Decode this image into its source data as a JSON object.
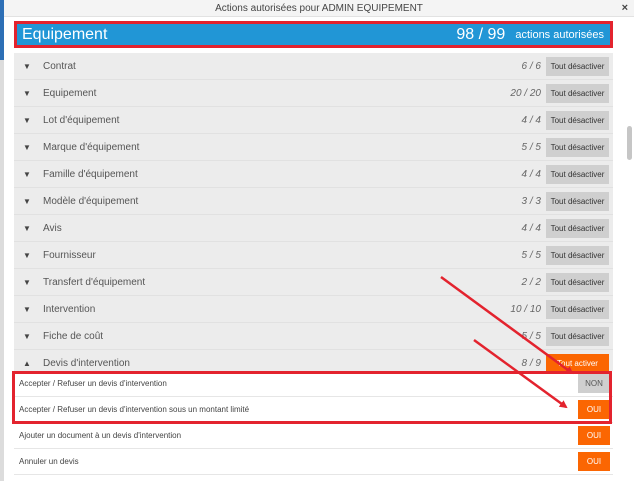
{
  "window": {
    "title": "Actions autorisées pour ADMIN EQUIPEMENT",
    "close_label": "×"
  },
  "header": {
    "title": "Equipement",
    "count": "98 / 99",
    "count_label": "actions autorisées"
  },
  "categories": [
    {
      "name": "Contrat",
      "ratio": "6 / 6",
      "button": "Tout désactiver",
      "button_style": "gray",
      "expanded": false
    },
    {
      "name": "Equipement",
      "ratio": "20 / 20",
      "button": "Tout désactiver",
      "button_style": "gray",
      "expanded": false
    },
    {
      "name": "Lot d'équipement",
      "ratio": "4 / 4",
      "button": "Tout désactiver",
      "button_style": "gray",
      "expanded": false
    },
    {
      "name": "Marque d'équipement",
      "ratio": "5 / 5",
      "button": "Tout désactiver",
      "button_style": "gray",
      "expanded": false
    },
    {
      "name": "Famille d'équipement",
      "ratio": "4 / 4",
      "button": "Tout désactiver",
      "button_style": "gray",
      "expanded": false
    },
    {
      "name": "Modèle d'équipement",
      "ratio": "3 / 3",
      "button": "Tout désactiver",
      "button_style": "gray",
      "expanded": false
    },
    {
      "name": "Avis",
      "ratio": "4 / 4",
      "button": "Tout désactiver",
      "button_style": "gray",
      "expanded": false
    },
    {
      "name": "Fournisseur",
      "ratio": "5 / 5",
      "button": "Tout désactiver",
      "button_style": "gray",
      "expanded": false
    },
    {
      "name": "Transfert d'équipement",
      "ratio": "2 / 2",
      "button": "Tout désactiver",
      "button_style": "gray",
      "expanded": false
    },
    {
      "name": "Intervention",
      "ratio": "10 / 10",
      "button": "Tout désactiver",
      "button_style": "gray",
      "expanded": false
    },
    {
      "name": "Fiche de coût",
      "ratio": "5 / 5",
      "button": "Tout désactiver",
      "button_style": "gray",
      "expanded": false
    },
    {
      "name": "Devis d'intervention",
      "ratio": "8 / 9",
      "button": "Tout activer",
      "button_style": "orange",
      "expanded": true
    }
  ],
  "sub_actions": [
    {
      "name": "Accepter / Refuser un devis d'intervention",
      "state": "NON"
    },
    {
      "name": "Accepter / Refuser un devis d'intervention sous un montant limité",
      "state": "OUI"
    },
    {
      "name": "Ajouter un document à un devis d'intervention",
      "state": "OUI"
    },
    {
      "name": "Annuler un devis",
      "state": "OUI"
    }
  ],
  "colors": {
    "header_blue": "#2196d6",
    "accent_orange": "#fb6602",
    "annotation_red": "#e3232e",
    "toggle_gray": "#cfcfcf"
  }
}
